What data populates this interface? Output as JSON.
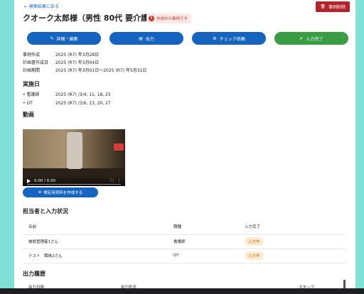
{
  "nav": {
    "back_label": "← 検索結果に戻る"
  },
  "header": {
    "delete_label": "事例削除",
    "title": "クオーク太郎様（男性 80代 要介護2）",
    "badge_label": "作成中の事例です"
  },
  "actions": {
    "edit_label": "詳細・編集",
    "output_label": "出力",
    "check_label": "チェック依頼",
    "complete_label": "入力完了"
  },
  "meta": [
    {
      "label": "事例作成",
      "value": "2025 (R7) 年3月28日"
    },
    {
      "label": "計画書作成日",
      "value": "2025 (R7) 年3月04日"
    },
    {
      "label": "計画期間",
      "value": "2025 (R7) 年3月01日～2025 (R7) 年5月31日"
    }
  ],
  "implementation": {
    "heading": "実施日",
    "rows": [
      {
        "label": "• 看護師",
        "value": "2025 (R7) /3/4, 11, 18, 25"
      },
      {
        "label": "• OT",
        "value": "2025 (R7) /3/6, 13, 20, 27"
      }
    ]
  },
  "video": {
    "heading": "動画",
    "time": "0:00 / 0:30",
    "make_button_label": "検定用資料を作成する"
  },
  "staff": {
    "heading": "担当者と入力状況",
    "columns": [
      "名前",
      "職種",
      "入力完了"
    ],
    "rows": [
      {
        "name": "施設管理者1さん",
        "role": "看護師",
        "status": "入力中"
      },
      {
        "name": "テスト　職員2さん",
        "role": "OT",
        "status": "入力中"
      }
    ]
  },
  "output": {
    "heading": "出力履歴",
    "columns": [
      "出力日時",
      "出力形式",
      "スタッフ"
    ]
  }
}
